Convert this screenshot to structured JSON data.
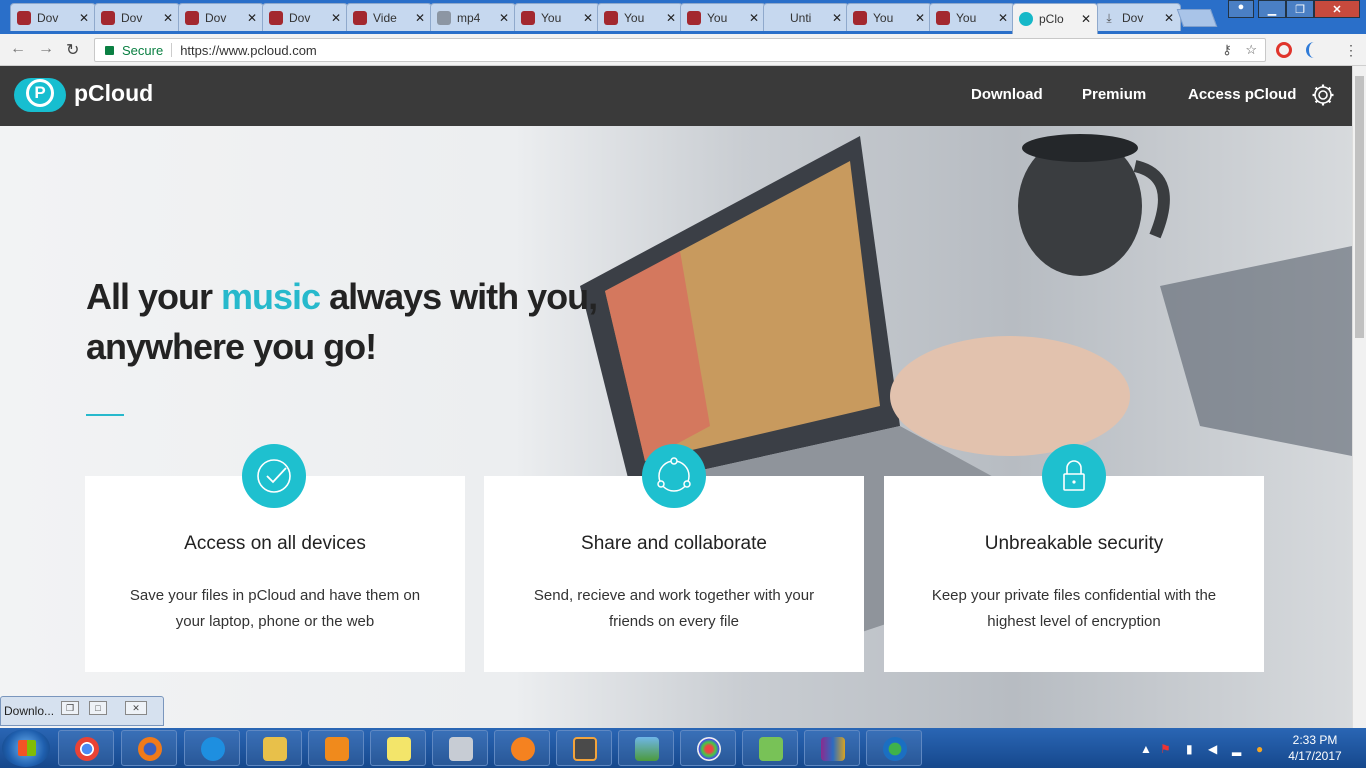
{
  "browser": {
    "tabs": [
      {
        "title": "Dov",
        "icon": "media-icon"
      },
      {
        "title": "Dov",
        "icon": "media-icon"
      },
      {
        "title": "Dov",
        "icon": "media-icon"
      },
      {
        "title": "Dov",
        "icon": "media-icon"
      },
      {
        "title": "Vide",
        "icon": "media-icon"
      },
      {
        "title": "mp4",
        "icon": "puzzle-icon"
      },
      {
        "title": "You",
        "icon": "pause-icon"
      },
      {
        "title": "You",
        "icon": "pause-icon"
      },
      {
        "title": "You",
        "icon": "pause-icon"
      },
      {
        "title": "Unti",
        "icon": "blank-page-icon"
      },
      {
        "title": "You",
        "icon": "pause-icon"
      },
      {
        "title": "You",
        "icon": "pause-icon"
      },
      {
        "title": "pClo",
        "icon": "pcloud-icon",
        "active": true
      },
      {
        "title": "Dov",
        "icon": "download-icon"
      }
    ],
    "tab_close_glyph": "✕",
    "secure_label": "Secure",
    "url": "https://www.pcloud.com"
  },
  "site": {
    "logo_text": "pCloud",
    "logo_letter": "P",
    "nav": {
      "download": "Download",
      "premium": "Premium",
      "access": "Access pCloud"
    },
    "headline": {
      "part1": "All your ",
      "accent": "music",
      "part2": " always with you, anywhere you go!"
    },
    "accent_color": "#27b9cc",
    "features": [
      {
        "title": "Access on all devices",
        "text": "Save your files in pCloud and have them on your laptop, phone or the web",
        "icon": "check-circle-icon"
      },
      {
        "title": "Share and collaborate",
        "text": "Send, recieve and work together with your friends on every file",
        "icon": "share-icon"
      },
      {
        "title": "Unbreakable security",
        "text": "Keep your private files confidential with the highest level of encryption",
        "icon": "lock-icon"
      }
    ]
  },
  "mini_window": {
    "title": "Downlo..."
  },
  "taskbar": {
    "apps": [
      "chrome",
      "firefox",
      "internet-explorer",
      "file-explorer",
      "media-player",
      "sticky-notes",
      "calculator",
      "avast",
      "sublime-text",
      "picture-viewer",
      "paint",
      "android",
      "winrar",
      "network-app"
    ],
    "time": "2:33 PM",
    "date": "4/17/2017"
  }
}
